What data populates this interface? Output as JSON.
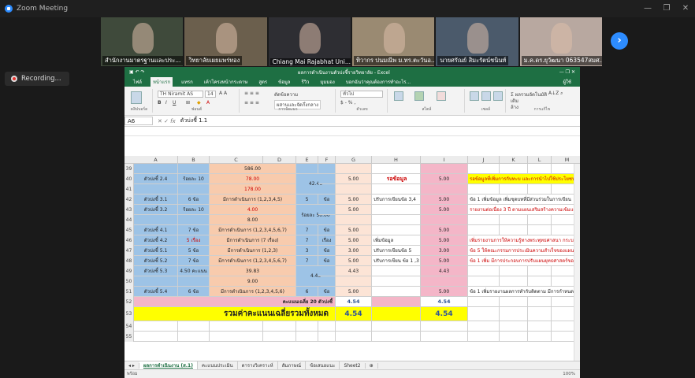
{
  "window": {
    "title": "Zoom Meeting",
    "minimize": "—",
    "maximize": "❐",
    "close": "✕"
  },
  "participants": [
    {
      "name": "สำนักงานมาตรฐานและประ...",
      "bg": "#3f4a3b"
    },
    {
      "name": "วิทยาลัยเผยแพร่ทอง",
      "bg": "#6b5f4d"
    },
    {
      "name": "Chiang Mai Rajabhat Uni...",
      "bg": "#2e2e33"
    },
    {
      "name": "ทิวากร ปนมณีพ ม.ทร.ตะวันอ...",
      "bg": "#9a8a72"
    },
    {
      "name": "นายศรัณย์ สิมะรัตน์ชนินท์",
      "bg": "#4b5a6b"
    },
    {
      "name": "ม.ค.ดร.ยุวัฒนา 063547สมศ...",
      "bg": "#b8a8a0"
    }
  ],
  "recording": {
    "label": "Recording..."
  },
  "excel": {
    "title": "ผลการดำเนินงานตัวบ่งชี้รายวิทยาลัย - Excel",
    "user": "ผู้ใช้",
    "tabs": [
      "ไฟล์",
      "หน้าแรก",
      "แทรก",
      "เค้าโครงหน้ากระดาษ",
      "สูตร",
      "ข้อมูล",
      "รีวิว",
      "มุมมอง",
      "บอกฉันว่าคุณต้องการทำอะไร..."
    ],
    "ribbon": {
      "font_name": "TH Niramit AS",
      "font_size": "14",
      "groups": [
        "คลิปบอร์ด",
        "ฟอนต์",
        "การจัดแนว",
        "ตัวเลข",
        "สไตล์",
        "เซลล์",
        "การแก้ไข"
      ],
      "wrap": "ตัดข้อความ",
      "merge": "ผสานและจัดกึ่งกลาง",
      "number_format": "ทั่วไป",
      "autosum": "ผลรวมอัตโนมัติ",
      "fill": "เติม",
      "clear": "ล้าง",
      "sort": "เรียงลำดับและกรอง",
      "find": "ค้นหาและเลือก",
      "cond_format": "การจัดรูปแบบตามเงื่อนไข",
      "format_table": "จัดรูปแบบเป็นตาราง",
      "cell_style": "สไตล์เซลล์",
      "insert": "แทรก",
      "delete": "ลบ",
      "format": "รูปแบบ"
    },
    "namebox": "A6",
    "formula": "ตัวบ่งชี้ 1.1",
    "columns": [
      "A",
      "B",
      "C",
      "D",
      "E",
      "F",
      "G",
      "H",
      "I",
      "J",
      "K",
      "L",
      "M"
    ],
    "rows": [
      {
        "n": "39",
        "C": "586.00"
      },
      {
        "n": "40",
        "A": "ตัวบ่งชี้ 2.4",
        "B": "ร้อยละ 10",
        "C": "78.00",
        "E": "42.46",
        "G": "5.00",
        "H": "รอข้อมูล",
        "I": "5.00",
        "J": "รอข้อมูลที่เพิ่มการกับทะบ และการนำไปใช้ประโยชน์"
      },
      {
        "n": "41",
        "C": "178.00"
      },
      {
        "n": "42",
        "A": "ตัวบ่งชี้ 3.1",
        "B": "6 ข้อ",
        "C": "มีการดำเนินการ (1,2,3,4,5)",
        "E": "5",
        "F": "ข้อ",
        "G": "5.00",
        "H": "ปรับการเขียนข้อ 3,4",
        "I": "5.00",
        "J": "ข้อ 1 เพิ่มข้อมูล เพิ่มชุดบทที่มีส่วนร่วมในการเขียน"
      },
      {
        "n": "43",
        "A": "ตัวบ่งชี้ 3.2",
        "B": "ร้อยละ 10",
        "C": "4.00",
        "E": "ร้อยละ 50.00",
        "G": "5.00",
        "I": "5.00",
        "J": "รายงานต่อเนื่อง 3 ปี ตามแผนเสริมสร้างความเข้มแข็ง"
      },
      {
        "n": "44",
        "C": "8.00"
      },
      {
        "n": "45",
        "A": "ตัวบ่งชี้ 4.1",
        "B": "7 ข้อ",
        "C": "มีการดำเนินการ (1,2,3,4,5,6,7)",
        "E": "7",
        "F": "ข้อ",
        "G": "5.00",
        "I": "5.00"
      },
      {
        "n": "46",
        "A": "ตัวบ่งชี้ 4.2",
        "B": "5 เรื่อง",
        "C": "มีการดำเนินการ (7 เรื่อง)",
        "E": "7",
        "F": "เรื่อง",
        "G": "5.00",
        "H": "เพิ่มข้อมูล",
        "I": "5.00",
        "J": "เพิ่มรายงานการให้ความรู้ทางพระพุทธศาสนา กระบวนการ"
      },
      {
        "n": "47",
        "A": "ตัวบ่งชี้ 5.1",
        "B": "5 ข้อ",
        "C": "มีการดำเนินการ (1,2,3)",
        "E": "3",
        "F": "ข้อ",
        "G": "3.00",
        "H": "ปรับการเขียนข้อ 5",
        "I": "3.00",
        "J": "ข้อ 5 ให้คณะกรรมการประเมินความสำเร็จของแผน"
      },
      {
        "n": "48",
        "A": "ตัวบ่งชี้ 5.2",
        "B": "7 ข้อ",
        "C": "มีการดำเนินการ (1,2,3,4,5,6,7)",
        "E": "7",
        "F": "ข้อ",
        "G": "5.00",
        "H": "ปรับการเขียน ข้อ 1 ,3",
        "I": "5.00",
        "J": "ข้อ 1 เพิ่ม มีการประกอบการปรับแผนยุทธศาสตร์ของแผน"
      },
      {
        "n": "49",
        "A": "ตัวบ่งชี้ 5.3",
        "B": "4.50 คะแนน",
        "C": "39.83",
        "E": "4.43",
        "G": "4.43",
        "I": "4.43"
      },
      {
        "n": "50",
        "C": "9.00"
      },
      {
        "n": "51",
        "A": "ตัวบ่งชี้ 5.4",
        "B": "6 ข้อ",
        "C": "มีการดำเนินการ (1,2,3,4,5,6)",
        "E": "6",
        "F": "ข้อ",
        "G": "5.00",
        "I": "5.00",
        "J": "ข้อ 1 เพิ่มรายงานผลการทำกับติดตาม มีการกำหนด"
      },
      {
        "n": "52",
        "avg_label": "คะแนนเฉลี่ย 20 ตัวบ่งชี้",
        "G": "4.54",
        "I": "4.54"
      },
      {
        "n": "53",
        "total_label": "รวมค่าคะแนนเฉลี่ยรวมทั้งหมด",
        "G": "4.54",
        "I": "4.54"
      },
      {
        "n": "54"
      },
      {
        "n": "55"
      }
    ],
    "sheets": [
      "ผลการดำเนินงาน (ส.1)",
      "คะแนนประเมิน",
      "ตารางวิเคราะห์",
      "สัมภาษณ์",
      "ข้อเสนอแนะ",
      "Sheet2",
      "⊕"
    ],
    "status": "พร้อม",
    "zoom": "100%"
  },
  "colors": {
    "orange": "#f8cbad",
    "blue": "#9dc3e6",
    "pink": "#f4b6c8",
    "yellow": "#ffff00",
    "peach": "#fce4d6",
    "excel_green": "#1e6f43",
    "zoom_blue": "#2d8cff"
  }
}
